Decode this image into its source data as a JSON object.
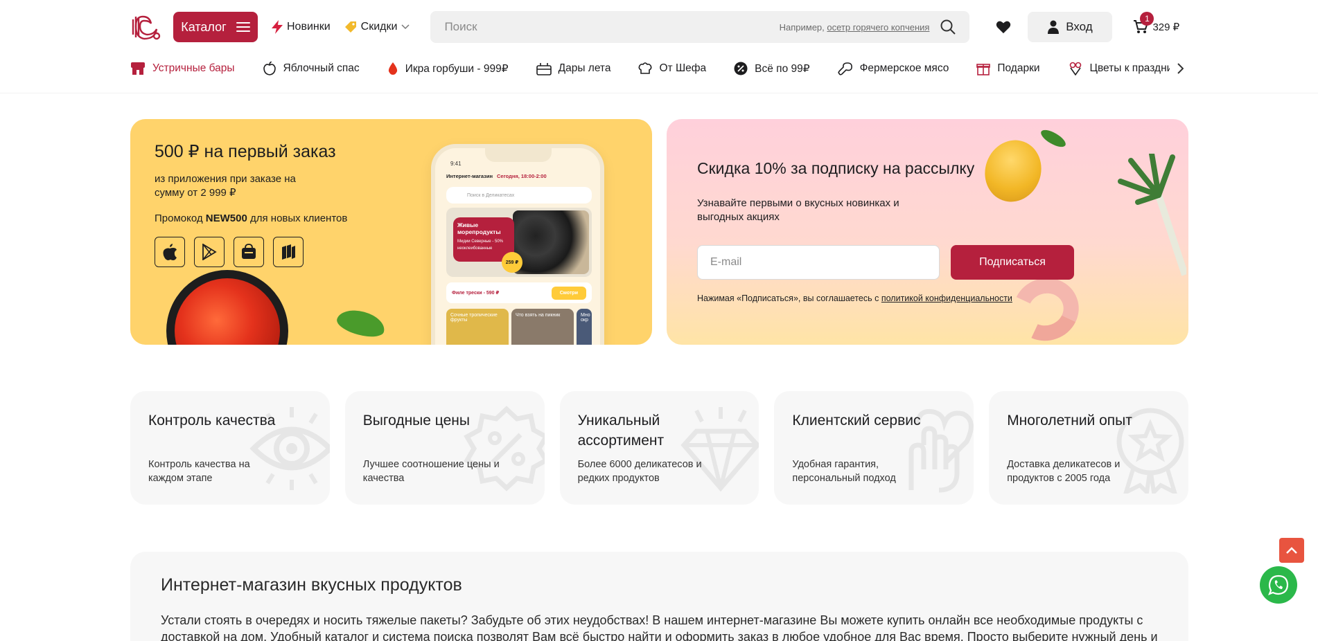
{
  "header": {
    "catalog_label": "Каталог",
    "news_label": "Новинки",
    "sales_label": "Скидки",
    "search_placeholder": "Поиск",
    "search_hint_prefix": "Например,",
    "search_hint_link": "осетр горячего копчения",
    "login_label": "Вход",
    "cart_count": "1",
    "cart_total": "329 ₽"
  },
  "categories": [
    {
      "label": "Устричные бары",
      "icon": "oyster-bar-icon",
      "active": true
    },
    {
      "label": "Яблочный спас",
      "icon": "apple-icon",
      "active": false
    },
    {
      "label": "Икра горбуши - 999₽",
      "icon": "caviar-drop-icon",
      "active": false
    },
    {
      "label": "Дары лета",
      "icon": "basket-icon",
      "active": false
    },
    {
      "label": "От Шефа",
      "icon": "chef-hat-icon",
      "active": false
    },
    {
      "label": "Всё по 99₽",
      "icon": "percent-badge-icon",
      "active": false
    },
    {
      "label": "Фермерское мясо",
      "icon": "drumstick-icon",
      "active": false
    },
    {
      "label": "Подарки",
      "icon": "gift-icon",
      "active": false
    },
    {
      "label": "Цветы к празднику",
      "icon": "flowers-icon",
      "active": false
    }
  ],
  "promo_banner": {
    "title": "500 ₽ на первый заказ",
    "subtitle": "из приложения при заказе на сумму от 2 999 ₽",
    "promo_prefix": "Промокод",
    "promo_code": "NEW500",
    "promo_suffix": "для новых клиентов",
    "stores": [
      "apple-store-icon",
      "google-play-icon",
      "huawei-gallery-icon",
      "rustore-icon"
    ],
    "phone": {
      "time": "9:41",
      "shop": "Интернет-магазин",
      "delivery": "Сегодня, 18:00-2:00",
      "search": "Поиск в Деликатесах",
      "card_title": "Живые морепродукты",
      "card_sub": "Мидии Северные - 50% неоклеибованные",
      "price": "259 ₽",
      "strip_item": "Филе трески - 590 ₽",
      "strip_btn": "Смотри",
      "tile1": "Сочные тропические фрукты",
      "tile2": "Что взять на пикник",
      "tile3": "Мно окр"
    }
  },
  "subscribe_banner": {
    "title": "Скидка 10% за подписку на рассылку",
    "subtitle": "Узнавайте первыми о вкусных новинках и выгодных акциях",
    "email_placeholder": "E-mail",
    "button_label": "Подписаться",
    "legal_prefix": "Нажимая «Подписаться», вы соглашаетесь с",
    "legal_link": "политикой конфиденциальности"
  },
  "features": [
    {
      "title": "Контроль качества",
      "text": "Контроль качества на каждом этапе",
      "icon": "eye-icon"
    },
    {
      "title": "Выгодные цены",
      "text": "Лучшее соотношение цены и качества",
      "icon": "percent-badge-icon"
    },
    {
      "title": "Уникальный ассортимент",
      "text": "Более 6000 деликатесов и редких продуктов",
      "icon": "diamond-icon"
    },
    {
      "title": "Клиентский сервис",
      "text": "Удобная гарантия, персональный подход",
      "icon": "heart-hand-icon"
    },
    {
      "title": "Многолетний опыт",
      "text": "Доставка деликатесов и продуктов с 2005 года",
      "icon": "medal-star-icon"
    }
  ],
  "about": {
    "title": "Интернет-магазин вкусных продуктов",
    "text": "Устали стоять в очередях и носить тяжелые пакеты? Забудьте об этих неудобствах! В нашем интернет-магазине Вы можете купить онлайн все необходимые продукты с доставкой на дом. Удобный каталог и система поиска позволят Вам всё быстро найти и оформить заказ в любое удобное для Вас время. Просто выберите нужный день и"
  },
  "colors": {
    "brand": "#b5203d",
    "promo_bg": "#ffd36b",
    "whatsapp": "#2bb84a",
    "scroll_top": "#e8543f"
  }
}
